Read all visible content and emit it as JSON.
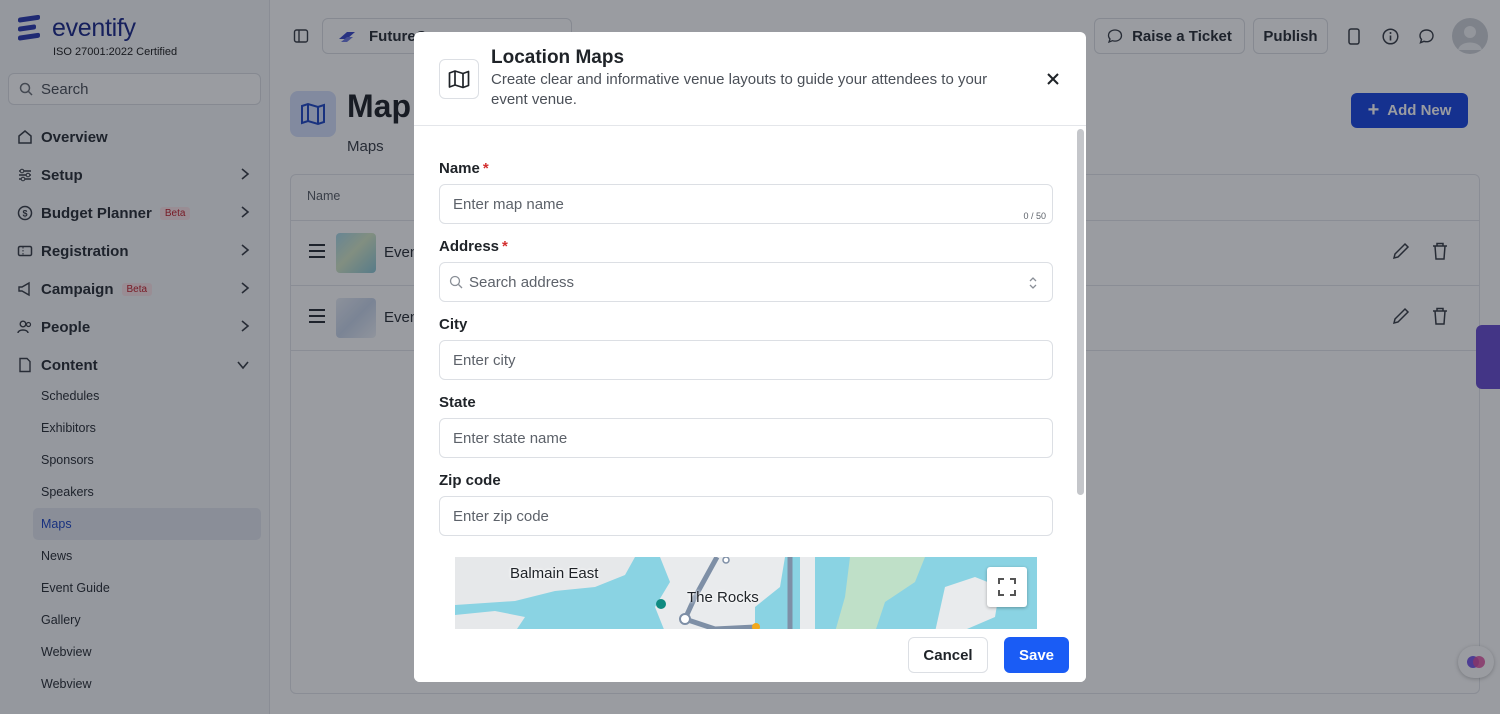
{
  "brand": {
    "name": "eventify",
    "certification": "ISO 27001:2022 Certified"
  },
  "sidebar": {
    "search_placeholder": "Search",
    "items": [
      {
        "label": "Overview",
        "icon": "home-icon"
      },
      {
        "label": "Setup",
        "icon": "sliders-icon"
      },
      {
        "label": "Budget Planner",
        "badge": "Beta",
        "icon": "dollar-icon"
      },
      {
        "label": "Registration",
        "icon": "ticket-icon"
      },
      {
        "label": "Campaign",
        "badge": "Beta",
        "icon": "megaphone-icon"
      },
      {
        "label": "People",
        "icon": "people-icon"
      },
      {
        "label": "Content",
        "icon": "document-icon"
      }
    ],
    "content_subitems": [
      "Schedules",
      "Exhibitors",
      "Sponsors",
      "Speakers",
      "Maps",
      "News",
      "Event Guide",
      "Gallery",
      "Webview",
      "Webview"
    ],
    "active_subitem": "Maps"
  },
  "topbar": {
    "event_name": "FutureC",
    "raise_ticket": "Raise a Ticket",
    "publish": "Publish"
  },
  "page": {
    "title": "Map",
    "breadcrumb": "Maps",
    "add_new": "Add New",
    "table_header_name": "Name",
    "rows": [
      {
        "name": "Even"
      },
      {
        "name": "Even"
      }
    ]
  },
  "modal": {
    "title": "Location Maps",
    "description": "Create clear and informative venue layouts to guide your attendees to your event venue.",
    "fields": {
      "name": {
        "label": "Name",
        "required": "*",
        "placeholder": "Enter map name",
        "counter": "0 / 50"
      },
      "address": {
        "label": "Address",
        "required": "*",
        "placeholder": "Search address"
      },
      "city": {
        "label": "City",
        "placeholder": "Enter city"
      },
      "state": {
        "label": "State",
        "placeholder": "Enter state name"
      },
      "zip": {
        "label": "Zip code",
        "placeholder": "Enter zip code"
      }
    },
    "map": {
      "labels": [
        "Balmain East",
        "The Rocks"
      ]
    },
    "cancel": "Cancel",
    "save": "Save"
  },
  "colors": {
    "primary": "#1a5cf5",
    "brand": "#1d2a8a",
    "required": "#d32f2f"
  }
}
